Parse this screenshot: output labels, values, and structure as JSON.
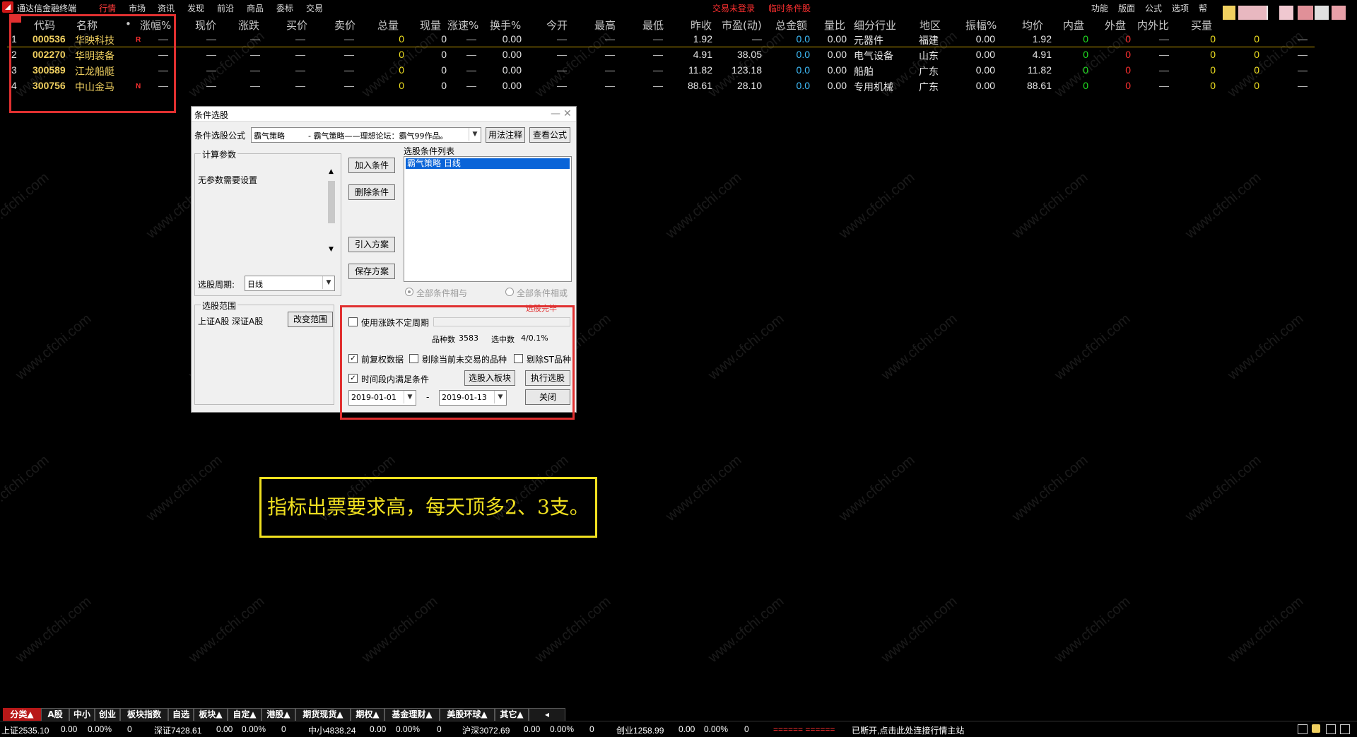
{
  "app": {
    "title": "通达信金融终端"
  },
  "menu": [
    "行情",
    "市场",
    "资讯",
    "发现",
    "前沿",
    "商品",
    "委标",
    "交易"
  ],
  "status_center": {
    "login": "交易未登录",
    "temp": "临时条件股"
  },
  "right_menu": [
    "功能",
    "版面",
    "公式",
    "选项",
    "帮"
  ],
  "columns": [
    "代码",
    "名称",
    "•",
    "涨幅%",
    "现价",
    "涨跌",
    "买价",
    "卖价",
    "总量",
    "现量",
    "涨速%",
    "换手%",
    "今开",
    "最高",
    "最低",
    "昨收",
    "市盈(动)",
    "总金额",
    "量比",
    "细分行业",
    "地区",
    "振幅%",
    "均价",
    "内盘",
    "外盘",
    "内外比",
    "买量"
  ],
  "rows": [
    {
      "idx": "1",
      "code": "000536",
      "name": "华映科技",
      "flag": "R",
      "chg": "—",
      "price": "—",
      "diff": "—",
      "bid": "—",
      "ask": "—",
      "vol": "0",
      "cur": "0",
      "speed": "—",
      "turn": "0.00",
      "open": "—",
      "high": "—",
      "low": "—",
      "prev": "1.92",
      "pe": "—",
      "amt": "0.0",
      "vr": "0.00",
      "ind": "元器件",
      "reg": "福建",
      "amp": "0.00",
      "avg": "1.92",
      "inn": "0",
      "out": "0",
      "io": "—",
      "bv": "0",
      "extra": "0",
      "dash": "—"
    },
    {
      "idx": "2",
      "code": "002270",
      "name": "华明装备",
      "flag": "",
      "chg": "—",
      "price": "—",
      "diff": "—",
      "bid": "—",
      "ask": "—",
      "vol": "0",
      "cur": "0",
      "speed": "—",
      "turn": "0.00",
      "open": "—",
      "high": "—",
      "low": "—",
      "prev": "4.91",
      "pe": "38.05",
      "amt": "0.0",
      "vr": "0.00",
      "ind": "电气设备",
      "reg": "山东",
      "amp": "0.00",
      "avg": "4.91",
      "inn": "0",
      "out": "0",
      "io": "—",
      "bv": "0",
      "extra": "0",
      "dash": "—"
    },
    {
      "idx": "3",
      "code": "300589",
      "name": "江龙船艇",
      "flag": "",
      "chg": "—",
      "price": "—",
      "diff": "—",
      "bid": "—",
      "ask": "—",
      "vol": "0",
      "cur": "0",
      "speed": "—",
      "turn": "0.00",
      "open": "—",
      "high": "—",
      "low": "—",
      "prev": "11.82",
      "pe": "123.18",
      "amt": "0.0",
      "vr": "0.00",
      "ind": "船舶",
      "reg": "广东",
      "amp": "0.00",
      "avg": "11.82",
      "inn": "0",
      "out": "0",
      "io": "—",
      "bv": "0",
      "extra": "0",
      "dash": "—"
    },
    {
      "idx": "4",
      "code": "300756",
      "name": "中山金马",
      "flag": "N",
      "chg": "—",
      "price": "—",
      "diff": "—",
      "bid": "—",
      "ask": "—",
      "vol": "0",
      "cur": "0",
      "speed": "—",
      "turn": "0.00",
      "open": "—",
      "high": "—",
      "low": "—",
      "prev": "88.61",
      "pe": "28.10",
      "amt": "0.0",
      "vr": "0.00",
      "ind": "专用机械",
      "reg": "广东",
      "amp": "0.00",
      "avg": "88.61",
      "inn": "0",
      "out": "0",
      "io": "—",
      "bv": "0",
      "extra": "0",
      "dash": "—"
    }
  ],
  "dialog": {
    "title": "条件选股",
    "formula_label": "条件选股公式",
    "formula_value": "霸气策略",
    "formula_desc": "- 霸气策略——理想论坛：霸气99作品。",
    "usage_btn": "用法注释",
    "view_btn": "查看公式",
    "params_group": "计算参数",
    "params_text": "无参数需要设置",
    "period_label": "选股周期:",
    "period_value": "日线",
    "add_btn": "加入条件",
    "del_btn": "删除条件",
    "import_btn": "引入方案",
    "save_btn": "保存方案",
    "cond_list_label": "选股条件列表",
    "cond_item": "霸气策略  日线",
    "radio_and": "全部条件相与",
    "radio_or": "全部条件相或",
    "range_group": "选股范围",
    "range_text": "上证A股 深证A股",
    "range_btn": "改变范围",
    "done_label": "选股完毕",
    "use_uncertain": "使用涨跌不定周期",
    "count_label": "品种数",
    "count_value": "3583",
    "selected_label": "选中数",
    "selected_value": "4/0.1%",
    "pre_adj": "前复权数据",
    "exclude_untrade": "剔除当前未交易的品种",
    "exclude_st": "剔除ST品种",
    "in_period": "时间段内满足条件",
    "to_block_btn": "选股入板块",
    "exec_btn": "执行选股",
    "date_from": "2019-01-01",
    "date_sep": "-",
    "date_to": "2019-01-13",
    "close_btn": "关闭"
  },
  "note": "指标出票要求高，每天顶多2、3支。",
  "tabs": [
    "分类▲",
    "A股",
    "中小",
    "创业",
    "板块指数",
    "自选",
    "板块▲",
    "自定▲",
    "港股▲",
    "期货现货▲",
    "期权▲",
    "基金理财▲",
    "美股环球▲",
    "其它▲"
  ],
  "status": {
    "sh": "上证2535.10",
    "sh_chg": "0.00",
    "sh_pct": "0.00%",
    "sh_vol": "0",
    "sz": "深证7428.61",
    "sz_chg": "0.00",
    "sz_pct": "0.00%",
    "sz_vol": "0",
    "zx": "中小4838.24",
    "zx_chg": "0.00",
    "zx_pct": "0.00%",
    "zx_vol": "0",
    "hs": "沪深3072.69",
    "hs_chg": "0.00",
    "hs_pct": "0.00%",
    "hs_vol": "0",
    "cy": "创业1258.99",
    "cy_chg": "0.00",
    "cy_pct": "0.00%",
    "cy_vol": "0",
    "dashes": "====== ======",
    "conn": "已断开,点击此处连接行情主站"
  },
  "watermark": "www.cfchi.com",
  "colors": {
    "accent": "#e03030",
    "gold": "#f0e020",
    "code": "#f0d060",
    "cyan": "#40c0ff",
    "green": "#20e020",
    "red": "#ff3030"
  }
}
